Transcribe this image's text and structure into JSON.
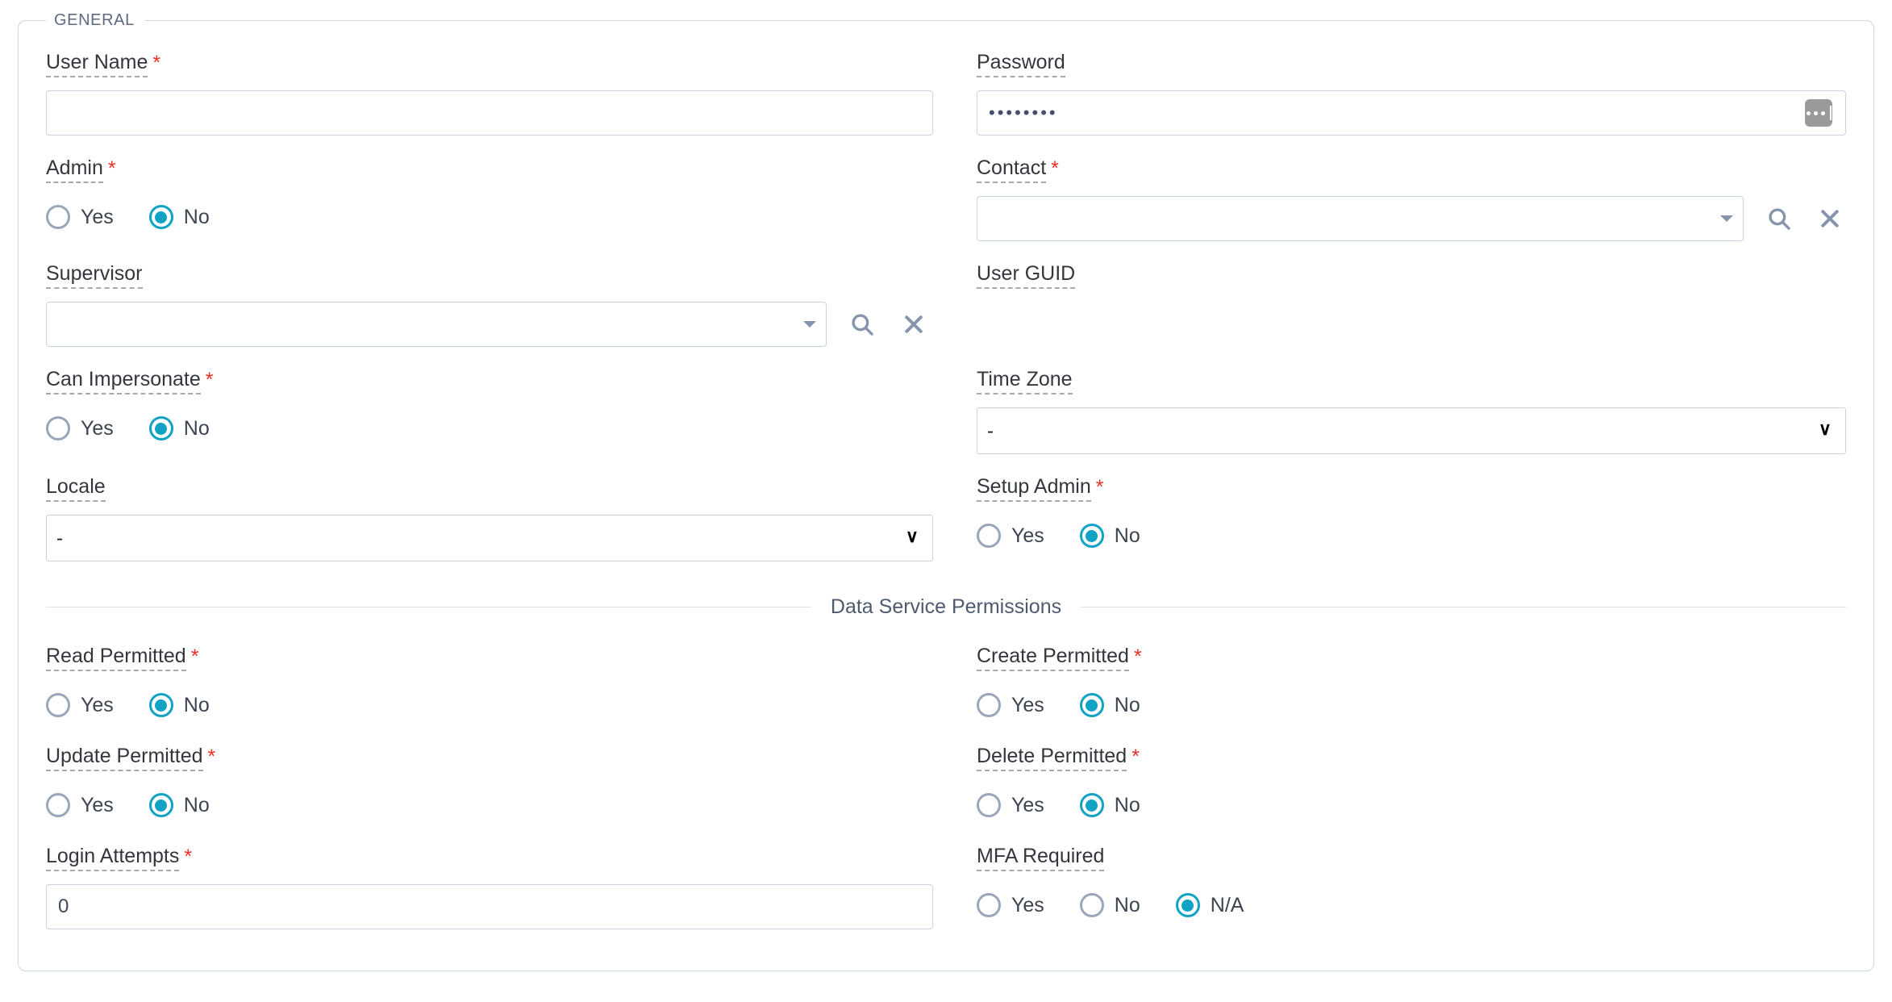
{
  "fieldset": {
    "legend": "GENERAL"
  },
  "fields": {
    "user_name": {
      "label": "User Name",
      "required": true,
      "value": ""
    },
    "password": {
      "label": "Password",
      "required": false,
      "value": "••••••••",
      "reveal_button": "password-options-button"
    },
    "admin": {
      "label": "Admin",
      "required": true,
      "options": [
        "Yes",
        "No"
      ],
      "selected": "No"
    },
    "contact": {
      "label": "Contact",
      "required": true,
      "value": "",
      "search_icon": "search-icon",
      "clear_icon": "clear-icon"
    },
    "supervisor": {
      "label": "Supervisor",
      "required": false,
      "value": "",
      "search_icon": "search-icon",
      "clear_icon": "clear-icon"
    },
    "user_guid": {
      "label": "User GUID",
      "required": false,
      "value": ""
    },
    "can_impersonate": {
      "label": "Can Impersonate",
      "required": true,
      "options": [
        "Yes",
        "No"
      ],
      "selected": "No"
    },
    "time_zone": {
      "label": "Time Zone",
      "required": false,
      "value": "-",
      "options": [
        "-"
      ]
    },
    "locale": {
      "label": "Locale",
      "required": false,
      "value": "-",
      "options": [
        "-"
      ]
    },
    "setup_admin": {
      "label": "Setup Admin",
      "required": true,
      "options": [
        "Yes",
        "No"
      ],
      "selected": "No"
    },
    "read_permitted": {
      "label": "Read Permitted",
      "required": true,
      "options": [
        "Yes",
        "No"
      ],
      "selected": "No"
    },
    "create_permitted": {
      "label": "Create Permitted",
      "required": true,
      "options": [
        "Yes",
        "No"
      ],
      "selected": "No"
    },
    "update_permitted": {
      "label": "Update Permitted",
      "required": true,
      "options": [
        "Yes",
        "No"
      ],
      "selected": "No"
    },
    "delete_permitted": {
      "label": "Delete Permitted",
      "required": true,
      "options": [
        "Yes",
        "No"
      ],
      "selected": "No"
    },
    "login_attempts": {
      "label": "Login Attempts",
      "required": true,
      "value": "0"
    },
    "mfa_required": {
      "label": "MFA Required",
      "required": false,
      "options": [
        "Yes",
        "No",
        "N/A"
      ],
      "selected": "N/A"
    }
  },
  "sections": {
    "data_service_permissions": "Data Service Permissions"
  },
  "required_marker": "*",
  "colors": {
    "accent_selected": "#12a2c4",
    "required_red": "#ef2e24",
    "field_border": "#c7d4e4",
    "label_text": "#33373d",
    "legend_text": "#5c6b80",
    "lookup_icon": "#8795ac"
  }
}
